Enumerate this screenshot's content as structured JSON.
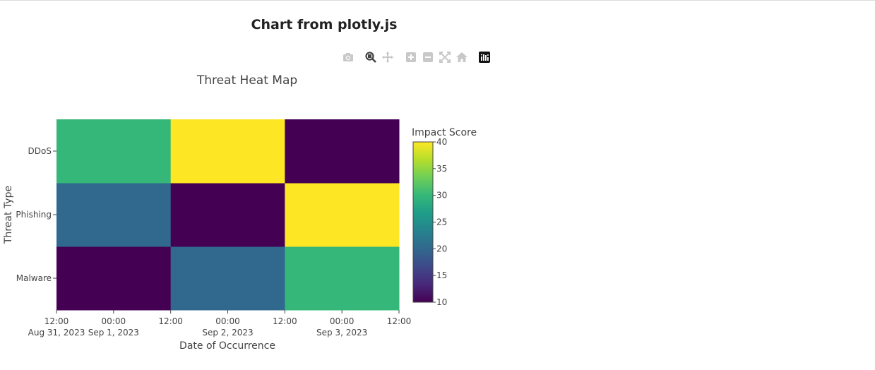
{
  "page": {
    "title": "Chart from plotly.js"
  },
  "modebar": {
    "buttons": [
      {
        "icon": "camera-icon",
        "label": "Download plot as a png",
        "active": false
      },
      {
        "icon": "zoom-icon",
        "label": "Zoom",
        "active": true
      },
      {
        "icon": "pan-icon",
        "label": "Pan",
        "active": false
      },
      {
        "icon": "zoom-in-icon",
        "label": "Zoom in",
        "active": false
      },
      {
        "icon": "zoom-out-icon",
        "label": "Zoom out",
        "active": false
      },
      {
        "icon": "autoscale-icon",
        "label": "Autoscale",
        "active": false
      },
      {
        "icon": "home-icon",
        "label": "Reset axes",
        "active": false
      },
      {
        "icon": "plotly-logo-icon",
        "label": "Produced with Plotly",
        "active": false
      }
    ]
  },
  "chart_data": {
    "type": "heatmap",
    "title": "Threat Heat Map",
    "xlabel": "Date of Occurrence",
    "ylabel": "Threat Type",
    "x": [
      "2023-09-01",
      "2023-09-02",
      "2023-09-03"
    ],
    "x_tick_labels": [
      {
        "time": "12:00",
        "date": "Aug 31, 2023"
      },
      {
        "time": "00:00",
        "date": "Sep 1, 2023"
      },
      {
        "time": "12:00",
        "date": ""
      },
      {
        "time": "00:00",
        "date": "Sep 2, 2023"
      },
      {
        "time": "12:00",
        "date": ""
      },
      {
        "time": "00:00",
        "date": "Sep 3, 2023"
      },
      {
        "time": "12:00",
        "date": ""
      }
    ],
    "y": [
      "Malware",
      "Phishing",
      "DDoS"
    ],
    "z": [
      [
        10,
        20,
        30
      ],
      [
        20,
        10,
        40
      ],
      [
        30,
        40,
        10
      ]
    ],
    "colorbar": {
      "title": "Impact Score",
      "range": [
        10,
        40
      ],
      "ticks": [
        10,
        15,
        20,
        25,
        30,
        35,
        40
      ]
    },
    "colorscale": "Viridis"
  }
}
